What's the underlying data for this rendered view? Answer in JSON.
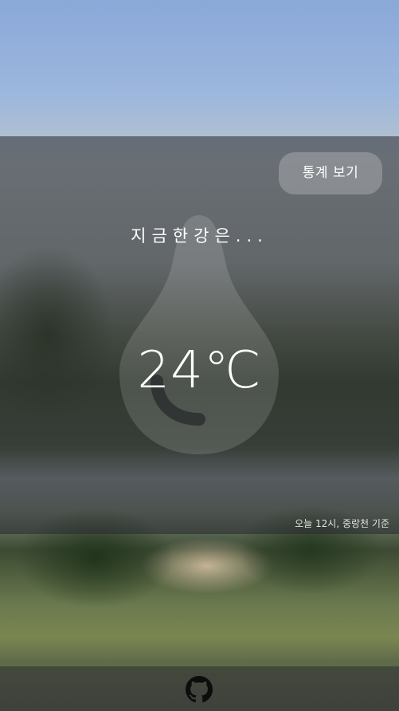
{
  "header": {
    "stats_button_label": "통계 보기"
  },
  "main": {
    "headline": "지금한강은...",
    "temperature": "24℃",
    "reference_note": "오늘 12시, 중랑천 기준"
  },
  "footer": {
    "icon": "github-icon"
  },
  "colors": {
    "overlay": "#28282d",
    "text": "#ffffff",
    "drop": "#ffffff"
  }
}
